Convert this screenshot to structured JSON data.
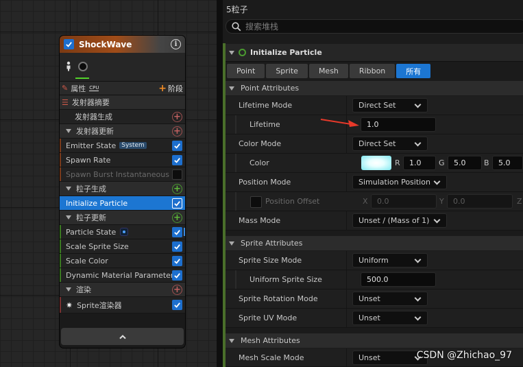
{
  "node": {
    "title": "ShockWave",
    "tab_label": "属性",
    "cpu_label": "CPU",
    "stage_label": "阶段",
    "rows": [
      {
        "label": "发射器摘要"
      },
      {
        "label": "发射器生成"
      },
      {
        "label": "发射器更新"
      },
      {
        "label": "Emitter State",
        "tag": "System"
      },
      {
        "label": "Spawn Rate"
      },
      {
        "label": "Spawn Burst Instantaneous"
      },
      {
        "label": "粒子生成"
      },
      {
        "label": "Initialize Particle"
      },
      {
        "label": "粒子更新"
      },
      {
        "label": "Particle State"
      },
      {
        "label": "Scale Sprite Size"
      },
      {
        "label": "Scale Color"
      },
      {
        "label": "Dynamic Material Parameters"
      },
      {
        "label": "渲染"
      },
      {
        "label": "Sprite渲染器"
      }
    ]
  },
  "panel": {
    "title": "5粒子",
    "search_placeholder": "搜索堆栈",
    "module_title": "Initialize Particle",
    "tabs": [
      "Point",
      "Sprite",
      "Mesh",
      "Ribbon",
      "所有"
    ],
    "sections": {
      "point": "Point Attributes",
      "sprite": "Sprite Attributes",
      "mesh": "Mesh Attributes"
    },
    "props": {
      "lifetime_mode": {
        "label": "Lifetime Mode",
        "value": "Direct Set"
      },
      "lifetime": {
        "label": "Lifetime",
        "value": "1.0"
      },
      "color_mode": {
        "label": "Color Mode",
        "value": "Direct Set"
      },
      "color": {
        "label": "Color",
        "r_label": "R",
        "r": "1.0",
        "g_label": "G",
        "g": "5.0",
        "b_label": "B",
        "b": "5.0"
      },
      "position_mode": {
        "label": "Position Mode",
        "value": "Simulation Position"
      },
      "position_offset": {
        "label": "Position Offset",
        "x_label": "X",
        "x": "0.0",
        "y_label": "Y",
        "y": "0.0",
        "z_label": "Z"
      },
      "mass_mode": {
        "label": "Mass Mode",
        "value": "Unset / (Mass of 1)"
      },
      "sprite_size_mode": {
        "label": "Sprite Size Mode",
        "value": "Uniform"
      },
      "uniform_sprite_size": {
        "label": "Uniform Sprite Size",
        "value": "500.0"
      },
      "sprite_rotation_mode": {
        "label": "Sprite Rotation Mode",
        "value": "Unset"
      },
      "sprite_uv_mode": {
        "label": "Sprite UV Mode",
        "value": "Unset"
      },
      "mesh_scale_mode": {
        "label": "Mesh Scale Mode",
        "value": "Unset"
      }
    }
  },
  "watermark": "CSDN @Zhichao_97",
  "colors": {
    "accent": "#1c76d2",
    "spawn": "#4a9a30",
    "arrow": "#e8392a",
    "header_orange": "#a04c18"
  }
}
